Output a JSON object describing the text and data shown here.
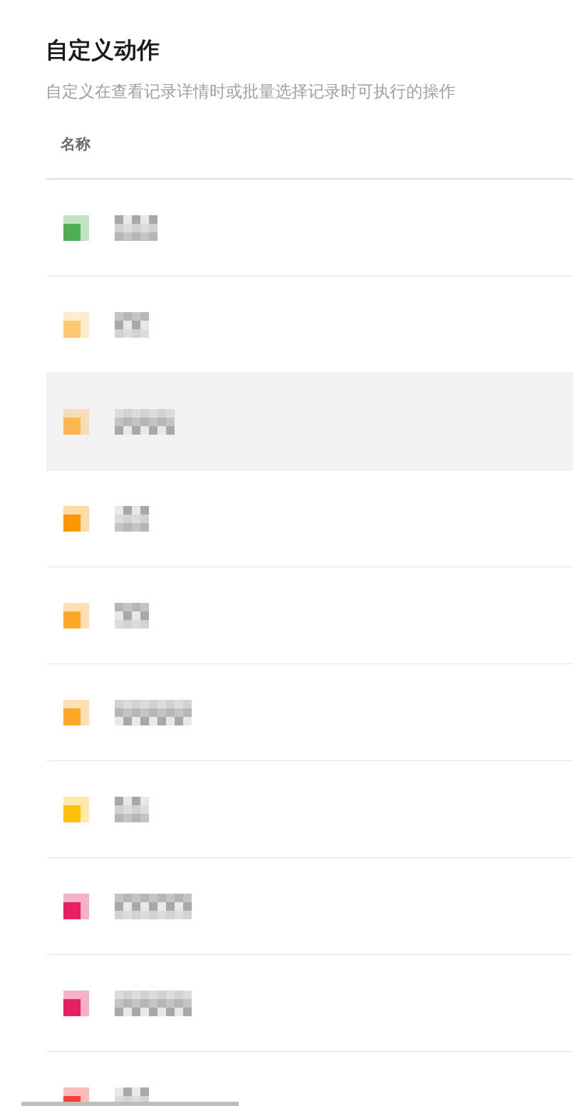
{
  "page": {
    "title": "自定义动作",
    "subtitle": "自定义在查看记录详情时或批量选择记录时可执行的操作"
  },
  "table": {
    "columns": [
      {
        "label": "名称"
      }
    ],
    "rows": [
      {
        "color": "#4caf50",
        "selected": false
      },
      {
        "color": "#ffc870",
        "selected": false
      },
      {
        "color": "#ffb74d",
        "selected": true
      },
      {
        "color": "#ff9800",
        "selected": false
      },
      {
        "color": "#ffa726",
        "selected": false
      },
      {
        "color": "#ffa726",
        "selected": false
      },
      {
        "color": "#ffc107",
        "selected": false
      },
      {
        "color": "#e91e63",
        "selected": false
      },
      {
        "color": "#e91e63",
        "selected": false
      },
      {
        "color": "#f44336",
        "selected": false
      }
    ]
  }
}
